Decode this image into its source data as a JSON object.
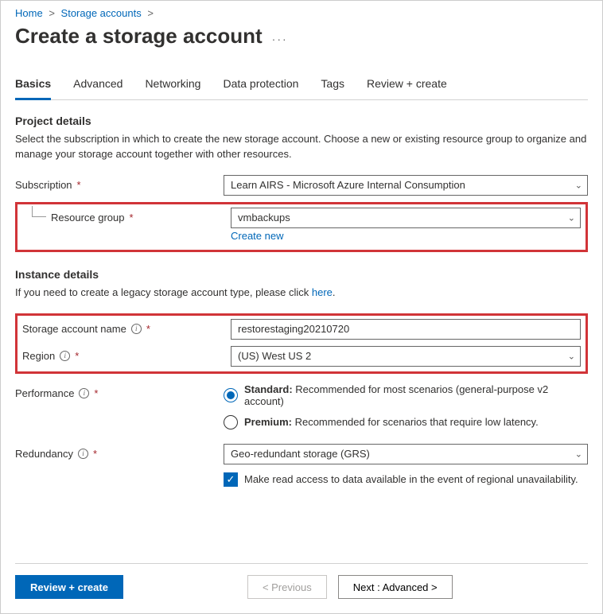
{
  "breadcrumb": {
    "items": [
      {
        "label": "Home"
      },
      {
        "label": "Storage accounts"
      }
    ]
  },
  "page": {
    "title": "Create a storage account"
  },
  "tabs": [
    {
      "label": "Basics",
      "active": true
    },
    {
      "label": "Advanced"
    },
    {
      "label": "Networking"
    },
    {
      "label": "Data protection"
    },
    {
      "label": "Tags"
    },
    {
      "label": "Review + create"
    }
  ],
  "project_details": {
    "heading": "Project details",
    "description": "Select the subscription in which to create the new storage account. Choose a new or existing resource group to organize and manage your storage account together with other resources.",
    "subscription_label": "Subscription",
    "subscription_value": "Learn AIRS - Microsoft Azure Internal Consumption",
    "resource_group_label": "Resource group",
    "resource_group_value": "vmbackups",
    "create_new_label": "Create new"
  },
  "instance_details": {
    "heading": "Instance details",
    "description_prefix": "If you need to create a legacy storage account type, please click ",
    "description_link": "here",
    "description_suffix": ".",
    "name_label": "Storage account name",
    "name_value": "restorestaging20210720",
    "region_label": "Region",
    "region_value": "(US) West US 2",
    "performance_label": "Performance",
    "performance_standard_bold": "Standard:",
    "performance_standard_text": " Recommended for most scenarios (general-purpose v2 account)",
    "performance_premium_bold": "Premium:",
    "performance_premium_text": " Recommended for scenarios that require low latency.",
    "redundancy_label": "Redundancy",
    "redundancy_value": "Geo-redundant storage (GRS)",
    "read_access_label": "Make read access to data available in the event of regional unavailability."
  },
  "footer": {
    "review_create": "Review + create",
    "previous": "< Previous",
    "next": "Next : Advanced >"
  }
}
